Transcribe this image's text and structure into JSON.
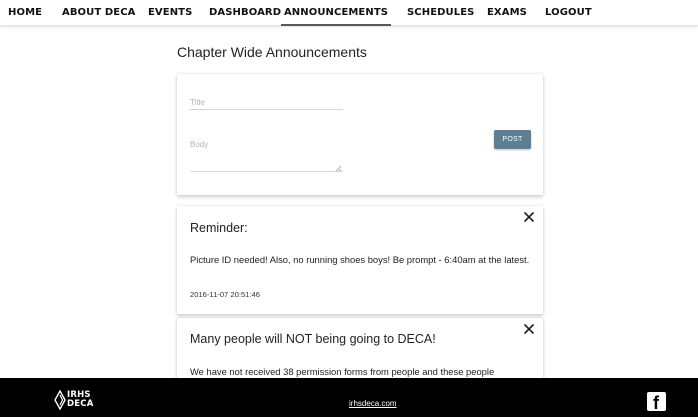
{
  "nav": {
    "items": [
      {
        "label": "HOME"
      },
      {
        "label": "ABOUT DECA"
      },
      {
        "label": "EVENTS"
      },
      {
        "label": "DASHBOARD"
      },
      {
        "label": "ANNOUNCEMENTS",
        "active": true
      },
      {
        "label": "SCHEDULES"
      },
      {
        "label": "EXAMS"
      },
      {
        "label": "LOGOUT"
      }
    ]
  },
  "page": {
    "title": "Chapter Wide Announcements"
  },
  "composer": {
    "title_placeholder": "Title",
    "body_placeholder": "Body",
    "post_label": "POST"
  },
  "announcements": [
    {
      "title": "Reminder:",
      "body": "Picture ID needed! Also, no running shoes boys! Be prompt - 6:40am at the latest.",
      "timestamp": "2016-11-07 20:51:46"
    },
    {
      "title": "Many people will NOT being going to DECA!",
      "body": "We have not received 38 permission forms from people and these people"
    }
  ],
  "footer": {
    "logo_line1": "IRHS",
    "logo_line2": "DECA",
    "link": "irhsdeca.com",
    "social_icon": "facebook-icon"
  },
  "colors": {
    "post_button": "#5d7f93",
    "footer_bg": "#000000",
    "nav_active_underline": "#5a5a5a"
  }
}
